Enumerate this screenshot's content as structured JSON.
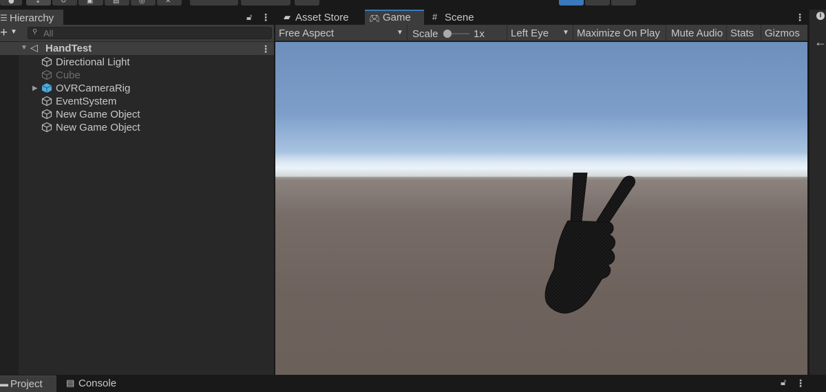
{
  "hierarchy": {
    "tab_label": "Hierarchy",
    "search_placeholder": "All",
    "scene_name": "HandTest",
    "items": [
      {
        "label": "Directional Light",
        "disabled": false,
        "has_children": false
      },
      {
        "label": "Cube",
        "disabled": true,
        "has_children": false
      },
      {
        "label": "OVRCameraRig",
        "disabled": false,
        "has_children": true
      },
      {
        "label": "EventSystem",
        "disabled": false,
        "has_children": false
      },
      {
        "label": "New Game Object",
        "disabled": false,
        "has_children": false
      },
      {
        "label": "New Game Object",
        "disabled": false,
        "has_children": false
      }
    ]
  },
  "game_panel": {
    "tabs": [
      {
        "label": "Asset Store",
        "icon": "bag-icon"
      },
      {
        "label": "Game",
        "icon": "gamepad-icon",
        "active": true
      },
      {
        "label": "Scene",
        "icon": "grid-icon"
      }
    ],
    "controls": {
      "aspect": "Free Aspect",
      "scale_label": "Scale",
      "scale_value": "1x",
      "eye": "Left Eye",
      "maximize": "Maximize On Play",
      "mute": "Mute Audio",
      "stats": "Stats",
      "gizmos": "Gizmos"
    }
  },
  "bottom": {
    "tabs": [
      {
        "label": "Project",
        "icon": "folder-icon",
        "active": true
      },
      {
        "label": "Console",
        "icon": "console-icon"
      }
    ]
  },
  "colors": {
    "accent": "#3a79bb",
    "panel_bg": "#282828",
    "tab_bg": "#3c3c3c",
    "ovr_icon": "#4ea9dc"
  }
}
